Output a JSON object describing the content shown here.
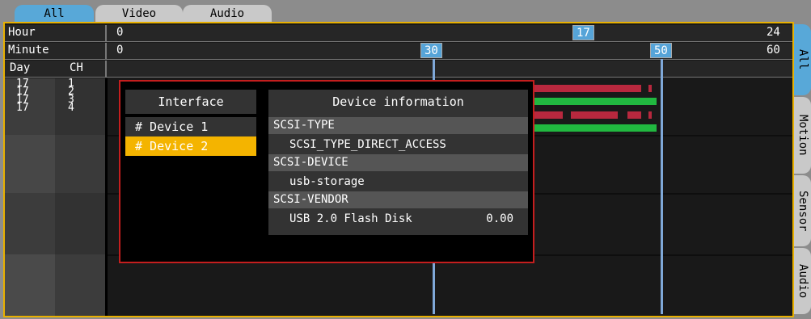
{
  "tabs": [
    {
      "label": "All"
    },
    {
      "label": "Video"
    },
    {
      "label": "Audio"
    }
  ],
  "header": {
    "hour_label": "Hour",
    "minute_label": "Minute",
    "day_label": "Day",
    "ch_label": "CH",
    "hour_start": "0",
    "hour_end": "24",
    "hour_marker": "17",
    "minute_start": "0",
    "minute_end": "60",
    "minute_marker_1": "30",
    "minute_marker_2": "50"
  },
  "rows": {
    "days": [
      "17",
      "17",
      "17",
      "17"
    ],
    "channels": [
      "1",
      "2",
      "3",
      "4"
    ]
  },
  "side_tabs": [
    {
      "label": "All"
    },
    {
      "label": "Motion"
    },
    {
      "label": "Sensor"
    },
    {
      "label": "Audio"
    }
  ],
  "popup": {
    "interface_title": "Interface",
    "devices": [
      {
        "label": "# Device 1"
      },
      {
        "label": "# Device 2"
      }
    ],
    "selected_device": "# Device 2",
    "info_title": "Device information",
    "fields": [
      {
        "label": "SCSI-TYPE",
        "value": "SCSI_TYPE_DIRECT_ACCESS"
      },
      {
        "label": "SCSI-DEVICE",
        "value": "usb-storage"
      },
      {
        "label": "SCSI-VENDOR",
        "value": "USB 2.0 Flash Disk",
        "extra": "0.00"
      }
    ]
  },
  "colors": {
    "accent_blue": "#58a8d8",
    "frame_orange": "#e8b000",
    "popup_border": "#c41e1e",
    "selected_item": "#f4b400",
    "event_red": "#b8283e",
    "event_green": "#21b840"
  }
}
